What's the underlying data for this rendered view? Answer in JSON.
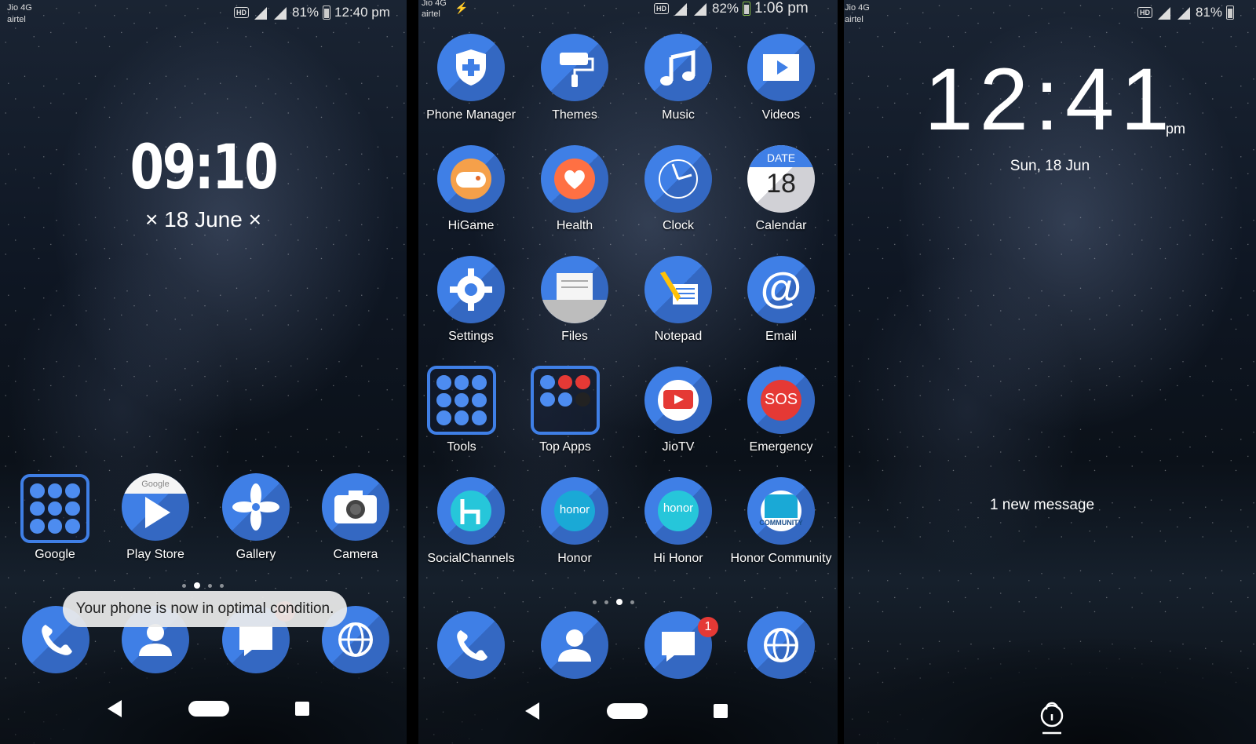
{
  "colors": {
    "icon_blue": "#3f7fe6",
    "badge_red": "#e53935"
  },
  "screen1": {
    "status": {
      "carrier1": "Jio 4G",
      "carrier2": "airtel",
      "hd": "HD",
      "battery": "81%",
      "time": "12:40 pm"
    },
    "clock": {
      "time": "09:10",
      "date": "× 18 June ×"
    },
    "apps": [
      {
        "label": "Google",
        "icon": "folder"
      },
      {
        "label": "Play Store",
        "icon": "play-store-icon",
        "brand": "Google"
      },
      {
        "label": "Gallery",
        "icon": "pinwheel-icon"
      },
      {
        "label": "Camera",
        "icon": "camera-icon"
      }
    ],
    "toast": "Your phone is now in optimal condition.",
    "dock": [
      {
        "icon": "phone-icon"
      },
      {
        "icon": "contacts-icon"
      },
      {
        "icon": "messages-icon",
        "badge": "1"
      },
      {
        "icon": "browser-icon"
      }
    ]
  },
  "screen2": {
    "status": {
      "carrier1": "Jio 4G",
      "carrier2": "airtel",
      "hd": "HD",
      "battery": "82%",
      "time": "1:06 pm"
    },
    "apps": [
      {
        "label": "Phone Manager",
        "icon": "shield-icon"
      },
      {
        "label": "Themes",
        "icon": "paint-roller-icon"
      },
      {
        "label": "Music",
        "icon": "music-note-icon"
      },
      {
        "label": "Videos",
        "icon": "video-icon"
      },
      {
        "label": "HiGame",
        "icon": "gamepad-icon"
      },
      {
        "label": "Health",
        "icon": "heart-icon"
      },
      {
        "label": "Clock",
        "icon": "clock-icon"
      },
      {
        "label": "Calendar",
        "icon": "calendar-icon",
        "cal_head": "DATE",
        "cal_day": "18"
      },
      {
        "label": "Settings",
        "icon": "gear-icon"
      },
      {
        "label": "Files",
        "icon": "files-icon"
      },
      {
        "label": "Notepad",
        "icon": "notepad-icon"
      },
      {
        "label": "Email",
        "icon": "at-sign-icon",
        "glyph": "@"
      },
      {
        "label": "Tools",
        "icon": "folder"
      },
      {
        "label": "Top Apps",
        "icon": "folder"
      },
      {
        "label": "JioTV",
        "icon": "jiotv-icon"
      },
      {
        "label": "Emergency",
        "icon": "sos-icon",
        "glyph": "SOS"
      },
      {
        "label": "SocialChannels",
        "icon": "socialchannels-icon"
      },
      {
        "label": "Honor",
        "icon": "honor-icon",
        "brand": "honor"
      },
      {
        "label": "Hi Honor",
        "icon": "hi-honor-icon",
        "brand": "honor"
      },
      {
        "label": "Honor Community",
        "icon": "honor-community-icon",
        "brand": "COMMUNITY"
      }
    ],
    "dock": [
      {
        "icon": "phone-icon"
      },
      {
        "icon": "contacts-icon"
      },
      {
        "icon": "messages-icon",
        "badge": "1"
      },
      {
        "icon": "browser-icon"
      }
    ]
  },
  "screen3": {
    "status": {
      "carrier1": "Jio 4G",
      "carrier2": "airtel",
      "hd": "HD",
      "battery": "81%"
    },
    "clock": {
      "time": "12:41",
      "ampm": "pm",
      "date": "Sun, 18 Jun"
    },
    "notification": "1 new message",
    "unlock_icon": "unlock-icon"
  }
}
